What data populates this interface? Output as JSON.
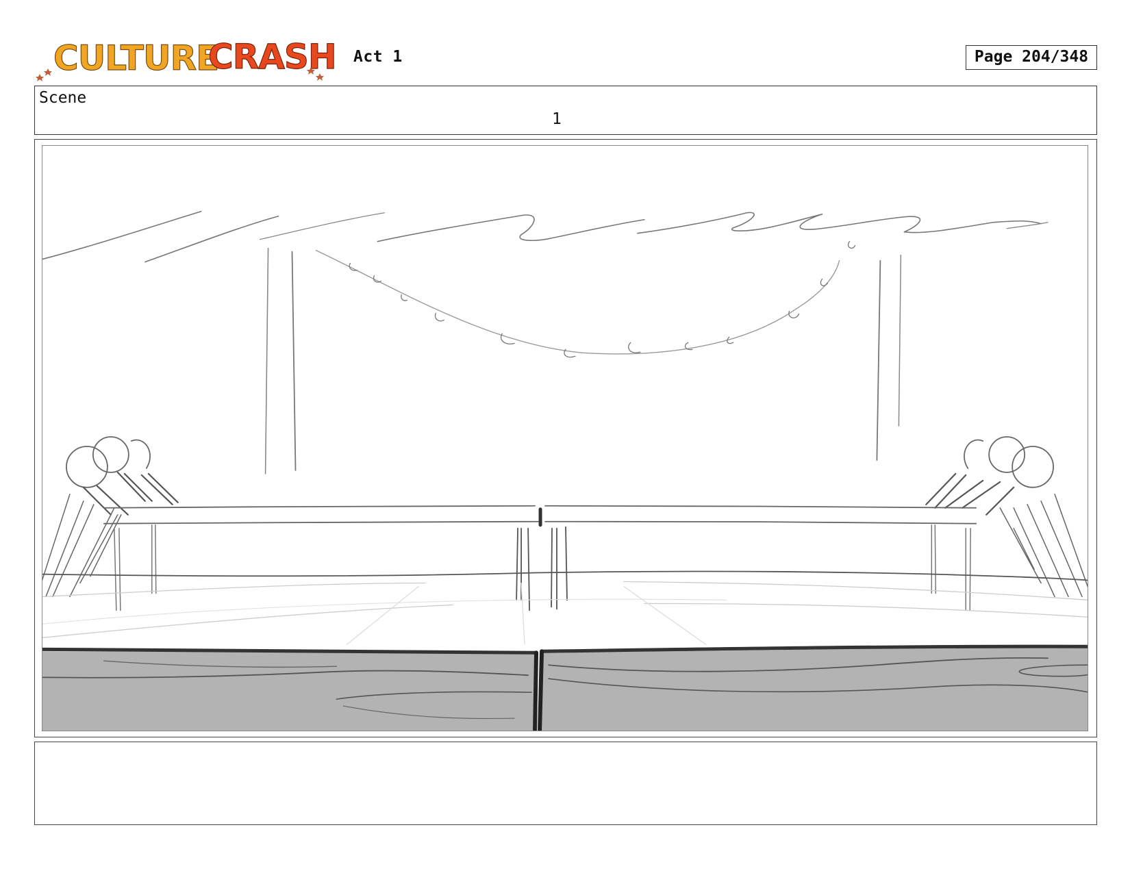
{
  "header": {
    "logo_text": "CULTURE CRASH",
    "act": "Act 1",
    "page": "Page 204/348"
  },
  "scene": {
    "label": "Scene",
    "number": "1"
  },
  "notes": {
    "text": ""
  },
  "colors": {
    "logo_culture": "#f0a623",
    "logo_crash": "#e8481e",
    "floor_front": "#b3b3b3"
  }
}
